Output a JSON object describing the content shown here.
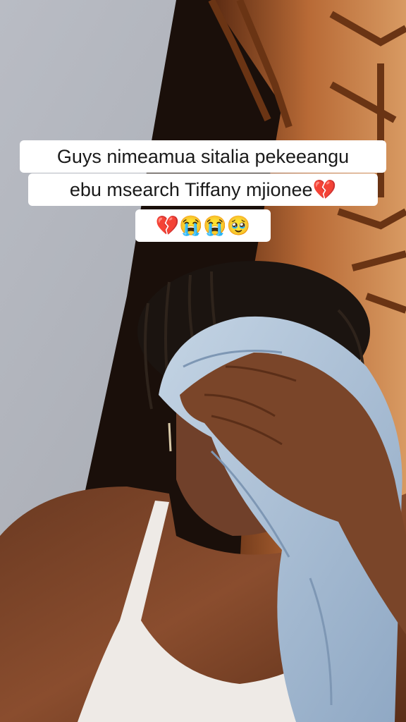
{
  "caption": {
    "line1": "Guys nimeamua sitalia pekeeangu",
    "line2": "ebu msearch Tiffany mjionee💔",
    "line3": "💔😭😭🥹"
  }
}
